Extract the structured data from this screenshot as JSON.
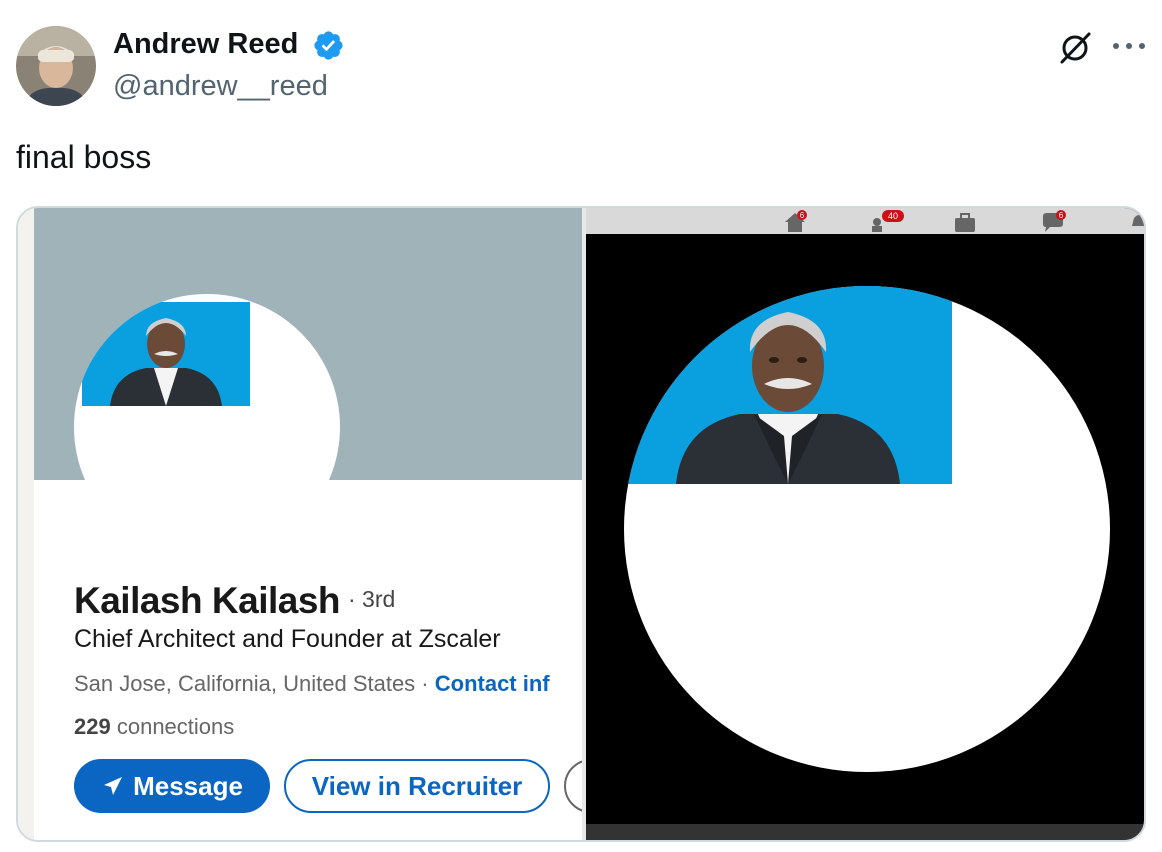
{
  "tweet": {
    "author_name": "Andrew Reed",
    "author_handle": "@andrew__reed",
    "text": "final boss"
  },
  "icons": {
    "verified": "verified-badge-icon",
    "grok": "grok-icon",
    "more": "more-options-icon"
  },
  "linkedin": {
    "name": "Kailash Kailash",
    "degree": "· 3rd",
    "headline": "Chief Architect and Founder at Zscaler",
    "location": "San Jose, California, United States ·",
    "contact": "Contact inf",
    "connections_count": "229",
    "connections_label": "connections",
    "message_label": "Message",
    "recruiter_label": "View in Recruiter"
  },
  "right_nav_badges": {
    "home": "6",
    "network": "40",
    "messages": "6"
  },
  "colors": {
    "verified": "#1d9bf0",
    "linkedin_blue": "#0a66c2",
    "cover_gray": "#a0b3b8",
    "photo_bg": "#0aa0e0"
  }
}
